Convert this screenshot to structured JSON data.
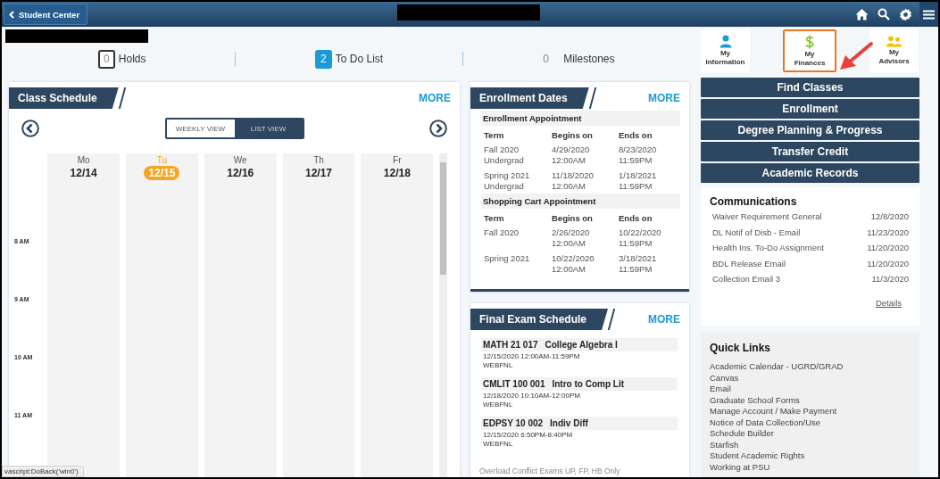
{
  "header": {
    "back_label": "Student Center"
  },
  "stats": [
    {
      "count": "0",
      "label": "Holds",
      "kind": "outlined"
    },
    {
      "count": "2",
      "label": "To Do List",
      "kind": "filled"
    },
    {
      "count": "0",
      "label": "Milestones",
      "kind": "plain"
    }
  ],
  "class_schedule": {
    "title": "Class Schedule",
    "more": "MORE",
    "views": [
      {
        "label": "WEEKLY VIEW",
        "selected": true
      },
      {
        "label": "LIST VIEW",
        "selected": false
      }
    ],
    "days": [
      {
        "day": "Mo",
        "date": "12/14",
        "selected": false
      },
      {
        "day": "Tu",
        "date": "12/15",
        "selected": true
      },
      {
        "day": "We",
        "date": "12/16",
        "selected": false
      },
      {
        "day": "Th",
        "date": "12/17",
        "selected": false
      },
      {
        "day": "Fr",
        "date": "12/18",
        "selected": false
      }
    ],
    "times": [
      "8 AM",
      "9 AM",
      "10 AM",
      "11 AM"
    ]
  },
  "enrollment_dates": {
    "title": "Enrollment Dates",
    "more": "MORE",
    "sections": [
      {
        "heading": "Enrollment Appointment",
        "columns": [
          "Term",
          "Begins on",
          "Ends on"
        ],
        "rows": [
          [
            "Fall 2020\nUndergrad",
            "4/29/2020\n12:00AM",
            "8/23/2020\n11:59PM"
          ],
          [
            "Spring 2021\nUndergrad",
            "11/18/2020\n12:00AM",
            "1/18/2021\n11:59PM"
          ]
        ]
      },
      {
        "heading": "Shopping Cart Appointment",
        "columns": [
          "Term",
          "Begins on",
          "Ends on"
        ],
        "rows": [
          [
            "Fall 2020",
            "2/26/2020\n12:00AM",
            "10/22/2020\n11:59PM"
          ],
          [
            "Spring 2021",
            "10/22/2020\n12:00AM",
            "3/18/2021\n11:59PM"
          ]
        ]
      }
    ]
  },
  "final_exams": {
    "title": "Final Exam Schedule",
    "more": "MORE",
    "exams": [
      {
        "course": "MATH 21 017",
        "name": "College Algebra I",
        "time": "12/15/2020 12:00AM-11:59PM",
        "location": "WEBFNL"
      },
      {
        "course": "CMLIT 100 001",
        "name": "Intro to Comp Lit",
        "time": "12/18/2020 10:10AM-12:00PM",
        "location": "WEBFNL"
      },
      {
        "course": "EDPSY 10 002",
        "name": "Indiv Diff",
        "time": "12/15/2020 6:50PM-8:40PM",
        "location": "WEBFNL"
      }
    ],
    "note": "Overload Conflict Exams UP, FP, HB Only"
  },
  "tiles": [
    {
      "label": "My\nInformation",
      "kind": "person",
      "highlighted": false
    },
    {
      "label": "My\nFinances",
      "kind": "dollar",
      "highlighted": true
    },
    {
      "label": "My\nAdvisors",
      "kind": "people",
      "highlighted": false
    }
  ],
  "nav_buttons": [
    "Find Classes",
    "Enrollment",
    "Degree Planning & Progress",
    "Transfer Credit",
    "Academic Records"
  ],
  "communications": {
    "title": "Communications",
    "items": [
      {
        "subject": "Waiver Requirement General",
        "date": "12/8/2020"
      },
      {
        "subject": "DL Notif of Disb - Email",
        "date": "11/23/2020"
      },
      {
        "subject": "Health Ins. To-Do Assignment",
        "date": "11/20/2020"
      },
      {
        "subject": "BDL Release Email",
        "date": "11/20/2020"
      },
      {
        "subject": "Collection Email 3",
        "date": "11/3/2020"
      }
    ],
    "details": "Details"
  },
  "quick_links": {
    "title": "Quick Links",
    "links": [
      "Academic Calendar - UGRD/GRAD",
      "Canvas",
      "Email",
      "Graduate School Forms",
      "Manage Account / Make Payment",
      "Notice of Data Collection/Use",
      "Schedule Builder",
      "Starfish",
      "Student Academic Rights",
      "Working at PSU"
    ]
  },
  "status_bar": {
    "text": "vascript:DoBack('win0')"
  }
}
